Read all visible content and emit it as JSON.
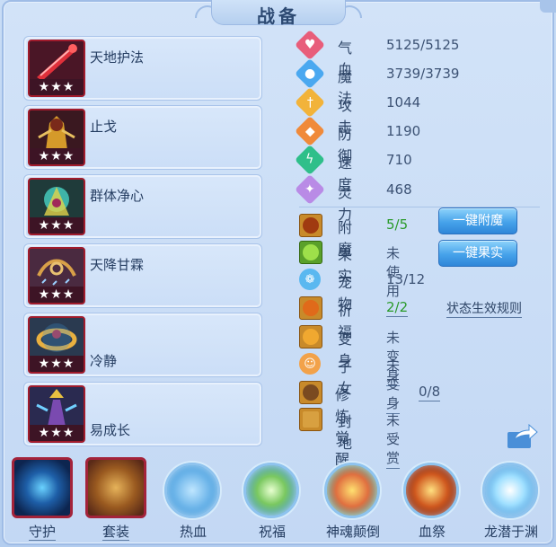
{
  "title": "战备",
  "skills": [
    {
      "name": "天地护法",
      "stars": "★★★"
    },
    {
      "name": "止戈",
      "stars": "★★★"
    },
    {
      "name": "群体净心",
      "stars": "★★★"
    },
    {
      "name": "天降甘霖",
      "stars": "★★★"
    },
    {
      "name": "冷静",
      "stars": "★★★"
    },
    {
      "name": "易成长",
      "stars": "★★★"
    }
  ],
  "stats": [
    {
      "label": "气血",
      "value": "5125/5125",
      "color": "#e85d7a",
      "icon": "heart-icon"
    },
    {
      "label": "魔法",
      "value": "3739/3739",
      "color": "#4aa8f0",
      "icon": "mana-icon"
    },
    {
      "label": "攻击",
      "value": "1044",
      "color": "#f2b33a",
      "icon": "attack-icon"
    },
    {
      "label": "防御",
      "value": "1190",
      "color": "#f08a3a",
      "icon": "defense-icon"
    },
    {
      "label": "速度",
      "value": "710",
      "color": "#2fbf8a",
      "icon": "speed-icon"
    },
    {
      "label": "灵力",
      "value": "468",
      "color": "#b98be6",
      "icon": "spirit-icon"
    }
  ],
  "extras": [
    {
      "label": "附魔",
      "value": "5/5",
      "icon": "enchant-icon"
    },
    {
      "label": "果实",
      "value": "未使用",
      "icon": "fruit-icon"
    },
    {
      "label": "宠物",
      "value": "13/12",
      "icon": "pet-icon"
    },
    {
      "label": "祈福",
      "value": "2/2",
      "icon": "blessing-icon"
    },
    {
      "label": "变身",
      "value": "未变身",
      "icon": "transform-icon"
    },
    {
      "label": "子女",
      "value": "未变身",
      "icon": "child-icon"
    },
    {
      "label": "修炼觉醒",
      "value": "0/8",
      "icon": "cultivation-icon"
    },
    {
      "label": "封地",
      "value": "未受赏",
      "icon": "fief-icon"
    }
  ],
  "buttons": {
    "enchant": "一键附魔",
    "fruit": "一键果实",
    "rules": "状态生效规则"
  },
  "bottom": [
    {
      "label": "守护",
      "icon": "guard-icon"
    },
    {
      "label": "套装",
      "icon": "armor-set-icon"
    },
    {
      "label": "热血",
      "icon": "passion-icon"
    },
    {
      "label": "祝福",
      "icon": "blessing-orb-icon"
    },
    {
      "label": "神魂颠倒",
      "icon": "soul-icon"
    },
    {
      "label": "血祭",
      "icon": "blood-sacrifice-icon"
    },
    {
      "label": "龙潜于渊",
      "icon": "dragon-icon"
    }
  ]
}
